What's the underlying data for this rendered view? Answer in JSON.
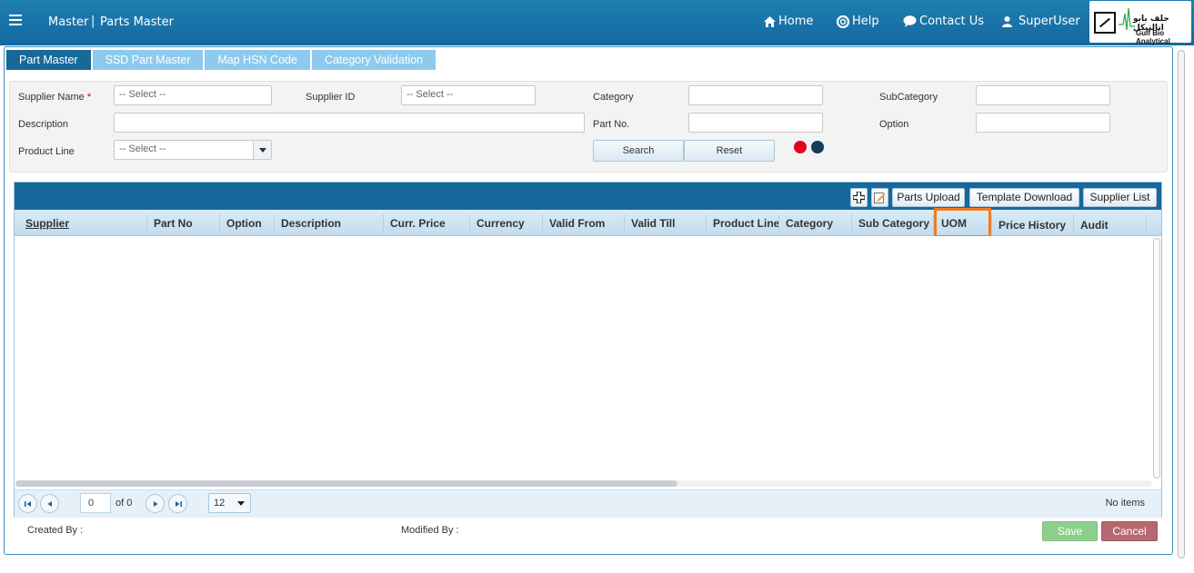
{
  "header": {
    "module": "Master",
    "page": "Parts Master",
    "separator": "|",
    "nav": {
      "home": "Home",
      "help": "Help",
      "contact": "Contact Us",
      "user": "SuperUser"
    },
    "logo_arabic": "جلف بايو انالتيكل",
    "logo_english": "Gulf Bio Analytical"
  },
  "tabs": [
    {
      "label": "Part Master",
      "active": true
    },
    {
      "label": "SSD Part Master",
      "active": false
    },
    {
      "label": "Map HSN Code",
      "active": false
    },
    {
      "label": "Category Validation",
      "active": false
    }
  ],
  "filters": {
    "supplier_name_label": "Supplier Name",
    "required_mark": "*",
    "supplier_name_placeholder": "-- Select --",
    "supplier_id_label": "Supplier ID",
    "supplier_id_placeholder": "-- Select --",
    "category_label": "Category",
    "category_value": "",
    "subcategory_label": "SubCategory",
    "subcategory_value": "",
    "description_label": "Description",
    "description_value": "",
    "part_no_label": "Part No.",
    "part_no_value": "",
    "option_label": "Option",
    "option_value": "",
    "product_line_label": "Product Line",
    "product_line_placeholder": "-- Select --",
    "search_button": "Search",
    "reset_button": "Reset",
    "status_colors": [
      "#e8001c",
      "#123c5a"
    ]
  },
  "grid": {
    "toolbar": {
      "add_icon": "plus-icon",
      "edit_icon": "edit-icon",
      "parts_upload": "Parts Upload",
      "template_download": "Template Download",
      "supplier_list": "Supplier List"
    },
    "columns": [
      "Supplier",
      "Part No",
      "Option",
      "Description",
      "Curr. Price",
      "Currency",
      "Valid From",
      "Valid Till",
      "Product Line",
      "Category",
      "Sub Category",
      "UOM",
      "Price History",
      "Audit"
    ],
    "highlight_color": "#f07a21",
    "rows": [],
    "pager": {
      "page": "0",
      "of_text": "of 0",
      "page_size": "12",
      "status": "No items"
    }
  },
  "footer": {
    "created_by_label": "Created By :",
    "modified_by_label": "Modified By :",
    "save_button": "Save",
    "cancel_button": "Cancel"
  }
}
